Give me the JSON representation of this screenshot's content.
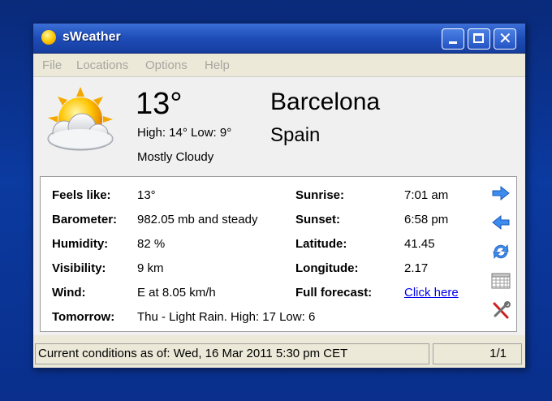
{
  "window": {
    "title": "sWeather"
  },
  "menu": [
    "File",
    "Locations",
    "Options",
    "Help"
  ],
  "current": {
    "temperature": "13°",
    "high_low": "High: 14° Low: 9°",
    "condition": "Mostly Cloudy",
    "city": "Barcelona",
    "country": "Spain",
    "icon": "partly-cloudy-sun-icon"
  },
  "details": {
    "left": [
      {
        "label": "Feels like:",
        "value": "13°"
      },
      {
        "label": "Barometer:",
        "value": "982.05 mb and steady"
      },
      {
        "label": "Humidity:",
        "value": "82 %"
      },
      {
        "label": "Visibility:",
        "value": "9 km"
      },
      {
        "label": "Wind:",
        "value": "E at 8.05 km/h"
      },
      {
        "label": "Tomorrow:",
        "value": "Thu - Light Rain. High: 17 Low: 6"
      }
    ],
    "right": [
      {
        "label": "Sunrise:",
        "value": "7:01 am"
      },
      {
        "label": "Sunset:",
        "value": "6:58 pm"
      },
      {
        "label": "Latitude:",
        "value": "41.45"
      },
      {
        "label": "Longitude:",
        "value": "2.17"
      },
      {
        "label": "Full forecast:",
        "value": "Click here"
      }
    ]
  },
  "side_icons": [
    "next-arrow-icon",
    "previous-arrow-icon",
    "refresh-icon",
    "calendar-icon",
    "settings-tools-icon"
  ],
  "status": {
    "left": "Current conditions as of: Wed, 16 Mar 2011 5:30 pm CET",
    "right": "1/1"
  },
  "colors": {
    "titlebar": "#1e4cb8",
    "link": "#0000ee",
    "menu_disabled": "#a7a6a0"
  }
}
